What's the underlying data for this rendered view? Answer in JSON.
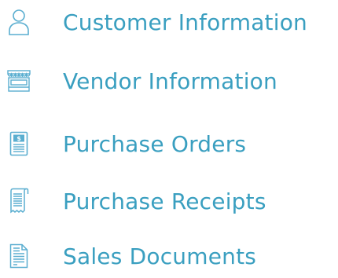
{
  "accent_color": "#3a9fc0",
  "icon_color": "#5aaed0",
  "menu": {
    "items": [
      {
        "label": "Customer Information",
        "icon": "person-icon"
      },
      {
        "label": "Vendor Information",
        "icon": "storefront-icon"
      },
      {
        "label": "Purchase Orders",
        "icon": "dollar-document-icon"
      },
      {
        "label": "Purchase Receipts",
        "icon": "receipt-icon"
      },
      {
        "label": "Sales Documents",
        "icon": "document-icon"
      }
    ]
  }
}
